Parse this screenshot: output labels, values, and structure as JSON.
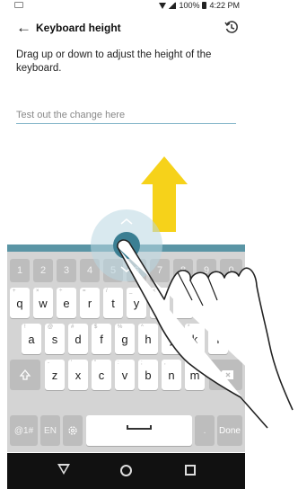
{
  "status_bar": {
    "battery": "100%",
    "time": "4:22 PM"
  },
  "app_bar": {
    "title": "Keyboard height",
    "back_icon": "arrow-left-icon",
    "history_icon": "restore-icon"
  },
  "instruction": "Drag up or down to adjust the height of the keyboard.",
  "test_field": {
    "placeholder": "Test out the change here"
  },
  "keyboard": {
    "numbers": [
      "1",
      "2",
      "3",
      "4",
      "5",
      "6",
      "7",
      "8",
      "9",
      "0"
    ],
    "row1": [
      "q",
      "w",
      "e",
      "r",
      "t",
      "y",
      "u",
      "i",
      "o",
      "p"
    ],
    "row2": [
      "a",
      "s",
      "d",
      "f",
      "g",
      "h",
      "j",
      "k",
      "l"
    ],
    "row3": [
      "z",
      "x",
      "c",
      "v",
      "b",
      "n",
      "m"
    ],
    "symbols_key": "@1#",
    "lang_key": "EN",
    "done_key": "Done"
  },
  "colors": {
    "handle": "#5a95a5",
    "arrow": "#f6d21a",
    "keyboard_bg": "#d4d4d4"
  }
}
